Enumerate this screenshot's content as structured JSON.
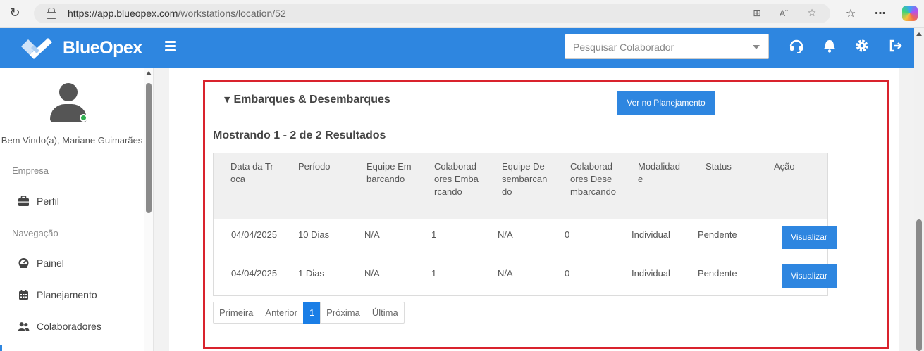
{
  "browser": {
    "url_host": "https://app.blueopex.com",
    "url_path": "/workstations/location/52"
  },
  "header": {
    "brand": "BlueOpex",
    "search_placeholder": "Pesquisar Colaborador"
  },
  "sidebar": {
    "welcome": "Bem Vindo(a), Mariane Guimarães",
    "sections": [
      {
        "heading": "Empresa",
        "items": [
          {
            "label": "Perfil",
            "icon": "briefcase-icon"
          }
        ]
      },
      {
        "heading": "Navegação",
        "items": [
          {
            "label": "Painel",
            "icon": "gauge-icon"
          },
          {
            "label": "Planejamento",
            "icon": "calendar-icon"
          },
          {
            "label": "Colaboradores",
            "icon": "users-icon"
          }
        ]
      }
    ]
  },
  "section": {
    "title": "Embarques & Desembarques",
    "plan_button": "Ver no Planejamento",
    "results_text": "Mostrando 1 - 2 de 2 Resultados"
  },
  "table": {
    "columns": [
      "Data da Troca",
      "Período",
      "Equipe Embarcando",
      "Colaboradores Embarcando",
      "Equipe Desembarcando",
      "Colaboradores Desembarcando",
      "Modalidade",
      "Status",
      "Ação"
    ],
    "rows": [
      {
        "date": "04/04/2025",
        "period": "10 Dias",
        "team_in": "N/A",
        "collab_in": "1",
        "team_out": "N/A",
        "collab_out": "0",
        "mode": "Individual",
        "status": "Pendente",
        "action": "Visualizar"
      },
      {
        "date": "04/04/2025",
        "period": "1 Dias",
        "team_in": "N/A",
        "collab_in": "1",
        "team_out": "N/A",
        "collab_out": "0",
        "mode": "Individual",
        "status": "Pendente",
        "action": "Visualizar"
      }
    ]
  },
  "pagination": {
    "first": "Primeira",
    "prev": "Anterior",
    "current": "1",
    "next": "Próxima",
    "last": "Última"
  },
  "colors": {
    "brand_blue": "#2e86e0",
    "highlight_red": "#d9232d",
    "online_green": "#2eae4e"
  }
}
